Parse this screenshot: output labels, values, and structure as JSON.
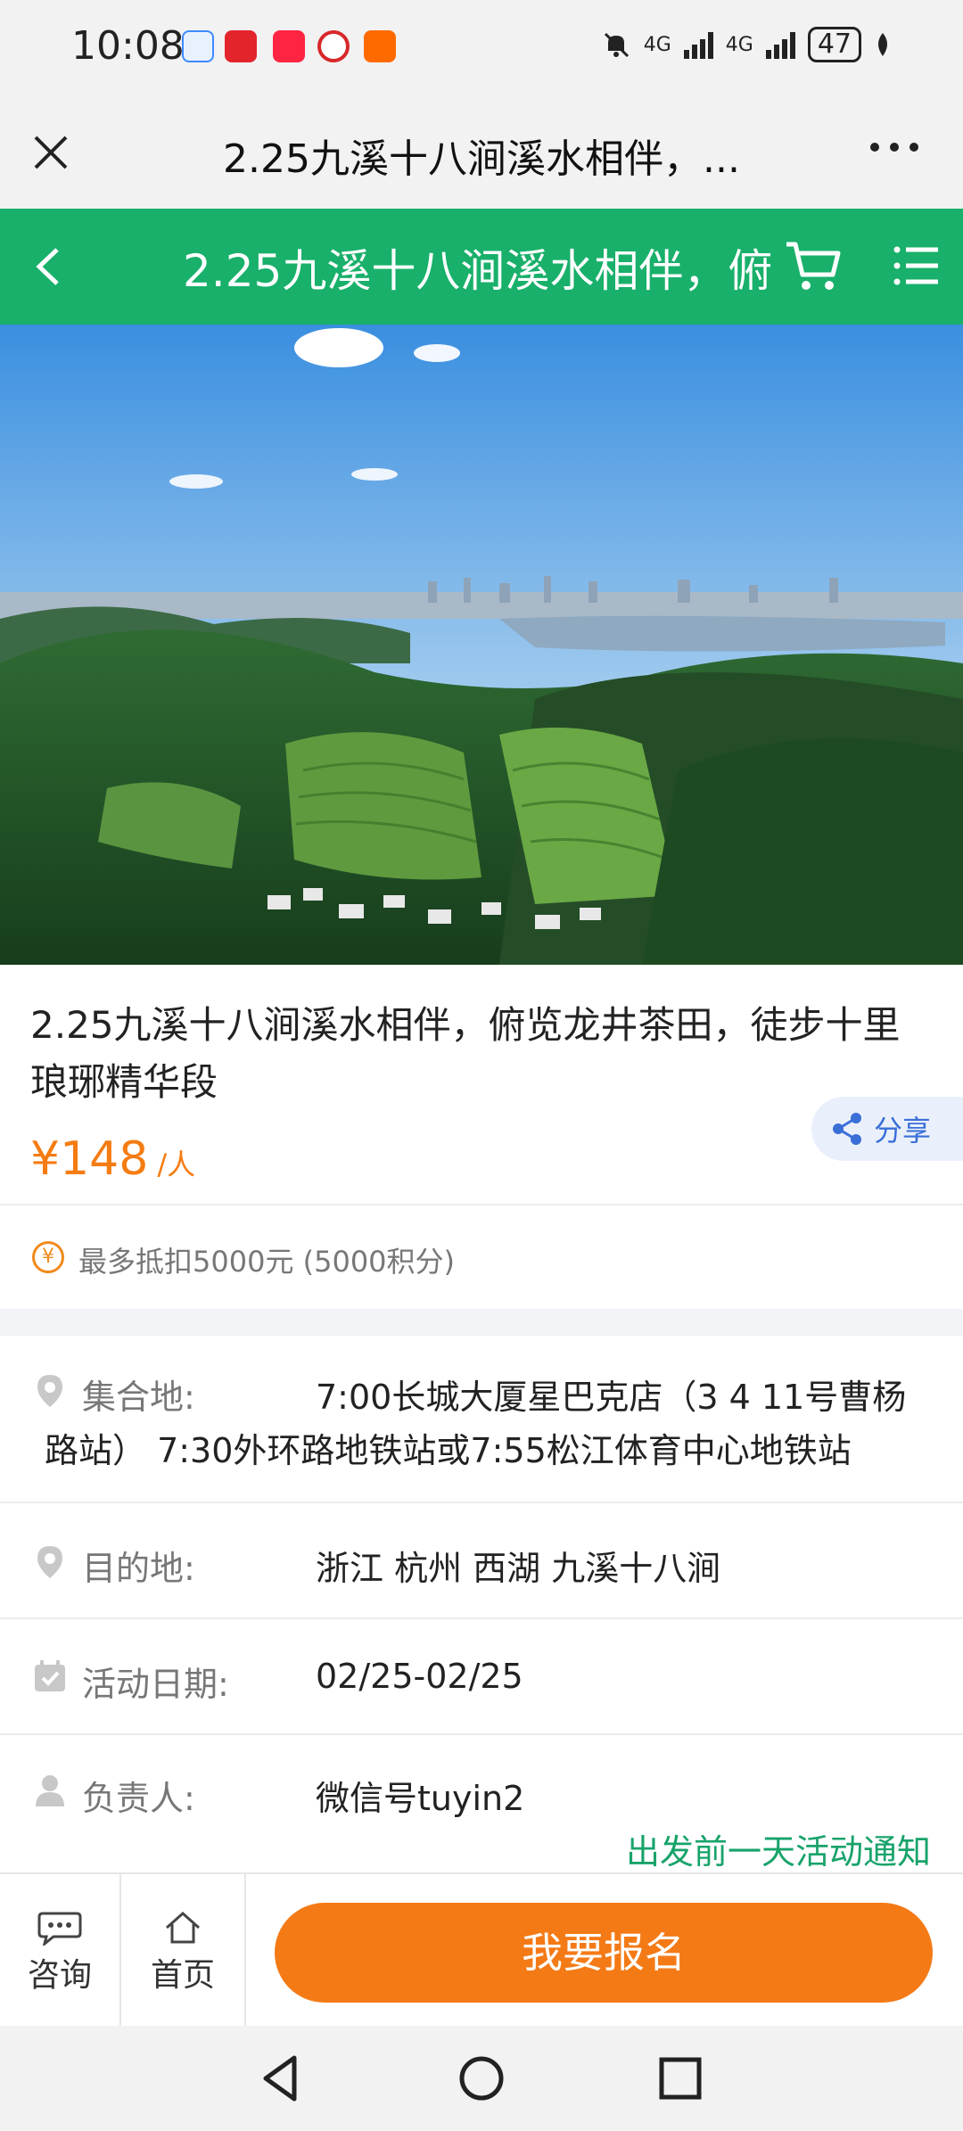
{
  "status_bar": {
    "time": "10:08",
    "network_1": "4G",
    "network_2": "4G",
    "battery": "47",
    "app_icons": [
      "chat-app-icon",
      "zhihu-app-icon",
      "xiaohongshu-app-icon",
      "bank-app-icon",
      "taobao-app-icon"
    ]
  },
  "webview": {
    "title": "2.25九溪十八涧溪水相伴，..."
  },
  "header": {
    "title": "2.25九溪十八涧溪水相伴，俯",
    "color": "#18b06a"
  },
  "trip": {
    "title": "2.25九溪十八涧溪水相伴，俯览龙井茶田，徒步十里琅琊精华段",
    "price": "¥148",
    "price_unit": "/人",
    "share_label": "分享",
    "points_text": "最多抵扣5000元 (5000积分)"
  },
  "details": {
    "meeting": {
      "label": "集合地:",
      "value_line1": "7:00长城大厦星巴克店（3 4 11号曹杨",
      "value_line2": "路站） 7:30外环路地铁站或7:55松江体育中心地铁站"
    },
    "destination": {
      "label": "目的地:",
      "value": "浙江 杭州 西湖 九溪十八涧"
    },
    "date": {
      "label": "活动日期:",
      "value": "02/25-02/25"
    },
    "leader": {
      "label": "负责人:",
      "value": "微信号tuyin2",
      "notice": "出发前一天活动通知"
    }
  },
  "action_bar": {
    "consult_label": "咨询",
    "home_label": "首页",
    "signup_label": "我要报名",
    "signup_color": "#f47a16"
  }
}
